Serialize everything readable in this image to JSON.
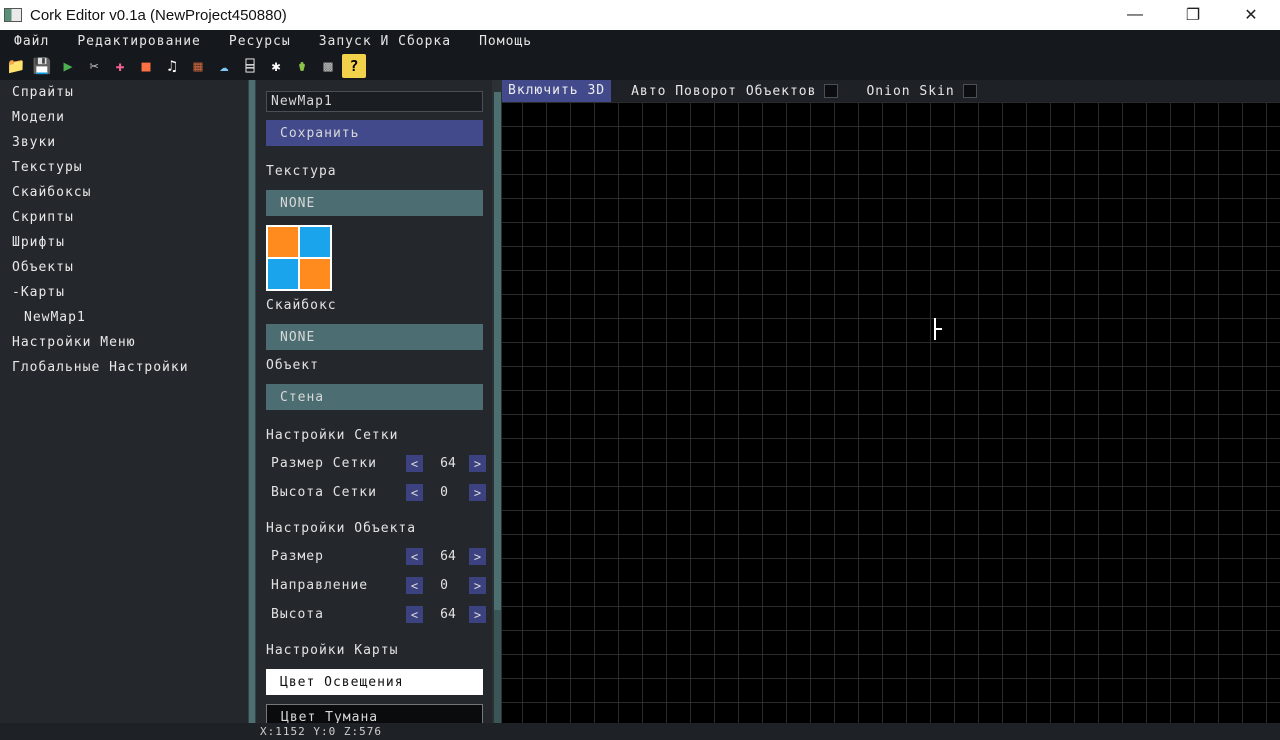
{
  "window": {
    "title": "Cork Editor v0.1a (NewProject450880)",
    "minimize": "—",
    "maximize": "❐",
    "close": "✕"
  },
  "menu": [
    "Файл",
    "Редактирование",
    "Ресурсы",
    "Запуск И Сборка",
    "Помощь"
  ],
  "toolbar": [
    {
      "icon": "folder-open-icon",
      "glyph": "📁",
      "color": "#e8b84a"
    },
    {
      "icon": "save-icon",
      "glyph": "💾",
      "color": "#6f8fb0"
    },
    {
      "icon": "run-build-icon",
      "glyph": "▶",
      "color": "#4caf50"
    },
    {
      "icon": "sprite-tool-icon",
      "glyph": "✂",
      "color": "#cfcfcf"
    },
    {
      "icon": "add-model-icon",
      "glyph": "✚",
      "color": "#f06292"
    },
    {
      "icon": "add-object-icon",
      "glyph": "■",
      "color": "#ff7043"
    },
    {
      "icon": "add-sound-icon",
      "glyph": "♫",
      "color": "#ffffff"
    },
    {
      "icon": "add-texture-icon",
      "glyph": "▦",
      "color": "#c0603a"
    },
    {
      "icon": "add-skybox-icon",
      "glyph": "☁",
      "color": "#7fc8f8"
    },
    {
      "icon": "add-script-icon",
      "glyph": "⌸",
      "color": "#ffffff"
    },
    {
      "icon": "add-font-icon",
      "glyph": "✱",
      "color": "#ffffff"
    },
    {
      "icon": "add-object-pot-icon",
      "glyph": "⚱",
      "color": "#8bc34a"
    },
    {
      "icon": "add-map-icon",
      "glyph": "▩",
      "color": "#bdbdbd"
    },
    {
      "icon": "help-icon",
      "glyph": "?",
      "color": "#000000"
    }
  ],
  "sidebar": {
    "items": [
      {
        "label": "Спрайты"
      },
      {
        "label": "Модели"
      },
      {
        "label": "Звуки"
      },
      {
        "label": "Текстуры"
      },
      {
        "label": "Скайбоксы"
      },
      {
        "label": "Скрипты"
      },
      {
        "label": "Шрифты"
      },
      {
        "label": "Объекты"
      },
      {
        "label": "-Карты"
      },
      {
        "label": "NewMap1"
      },
      {
        "label": "Настройки Меню"
      },
      {
        "label": "Глобальные Настройки"
      }
    ]
  },
  "props": {
    "map_name": "NewMap1",
    "save_label": "Сохранить",
    "texture_label": "Текстура",
    "texture_value": "NONE",
    "skybox_label": "Скайбокс",
    "skybox_value": "NONE",
    "object_label": "Объект",
    "object_value": "Стена",
    "grid_section": "Настройки Сетки",
    "grid_size_label": "Размер Сетки",
    "grid_size_value": "64",
    "grid_height_label": "Высота Сетки",
    "grid_height_value": "0",
    "object_section": "Настройки Объекта",
    "obj_size_label": "Размер",
    "obj_size_value": "64",
    "obj_dir_label": "Направление",
    "obj_dir_value": "0",
    "obj_height_label": "Высота",
    "obj_height_value": "64",
    "map_section": "Настройки Карты",
    "light_color_label": "Цвет Освещения",
    "fog_color_label": "Цвет Тумана",
    "dec": "<",
    "inc": ">"
  },
  "viewport": {
    "toggle_3d": "Включить 3D",
    "auto_rotate_label": "Авто Поворот Объектов",
    "auto_rotate_checked": false,
    "onion_skin_label": "Onion Skin",
    "onion_skin_checked": false
  },
  "status": {
    "coords": "X:1152 Y:0 Z:576"
  }
}
